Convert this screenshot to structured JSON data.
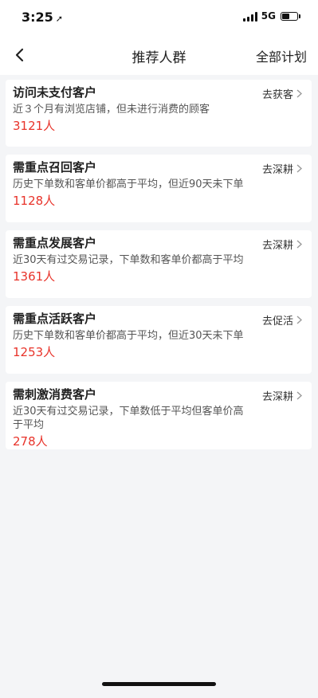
{
  "status": {
    "time": "3:25",
    "network": "5G"
  },
  "nav": {
    "title": "推荐人群",
    "action": "全部计划"
  },
  "cards": [
    {
      "title": "访问未支付客户",
      "desc": "近３个月有浏览店铺，但未进行消费的顾客",
      "count": "3121人",
      "action": "去获客"
    },
    {
      "title": "需重点召回客户",
      "desc": "历史下单数和客单价都高于平均，但近90天未下单",
      "count": "1128人",
      "action": "去深耕"
    },
    {
      "title": "需重点发展客户",
      "desc": "近30天有过交易记录，下单数和客单价都高于平均",
      "count": "1361人",
      "action": "去深耕"
    },
    {
      "title": "需重点活跃客户",
      "desc": "历史下单数和客单价都高于平均，但近30天未下单",
      "count": "1253人",
      "action": "去促活"
    },
    {
      "title": "需刺激消费客户",
      "desc": "近30天有过交易记录，下单数低于平均但客单价高于平均",
      "count": "278人",
      "action": "去深耕"
    }
  ],
  "colors": {
    "accent": "#e8332a",
    "background": "#f4f5f7"
  }
}
